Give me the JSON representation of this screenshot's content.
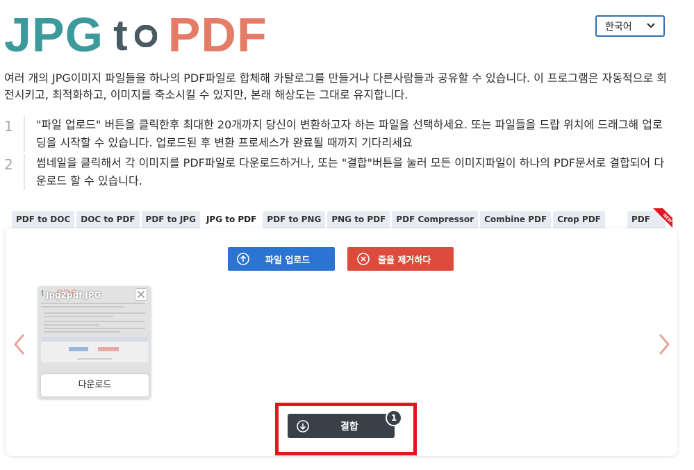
{
  "logo": {
    "part1": "JPG",
    "part2": "t",
    "part3": "PDF"
  },
  "language": {
    "selected": "한국어"
  },
  "intro": "여러 개의 JPG이미지 파일들을 하나의 PDF파일로 합체해 카탈로그를 만들거나 다른사람들과 공유할 수 있습니다. 이 프로그램은 자동적으로 회전시키고, 최적화하고, 이미지를 축소시킬 수 있지만, 본래 해상도는 그대로 유지합니다.",
  "steps": [
    {
      "num": "1",
      "text": "\"파일 업로드\" 버튼을 클릭한후 최대한 20개까지 당신이 변환하고자 하는 파일을 선택하세요. 또는 파일들을 드랍 위치에 드래그해 업로딩을 시작할 수 있습니다. 업로드된 후 변환 프로세스가 완료될 때까지 기다리세요"
    },
    {
      "num": "2",
      "text": "썸네일을 클릭해서 각 이미지를 PDF파일로 다운로드하거나, 또는 \"결합\"버튼을 눌러 모든 이미지파일이 하나의 PDF문서로 결합되어 다운로드 할 수 있습니다."
    }
  ],
  "tabs": [
    "PDF to DOC",
    "DOC to PDF",
    "PDF to JPG",
    "JPG to PDF",
    "PDF to PNG",
    "PNG to PDF",
    "PDF Compressor",
    "Combine PDF",
    "Crop PDF"
  ],
  "tab_right": "PDF Kit",
  "new_ribbon": "NEW",
  "buttons": {
    "upload": "파일 업로드",
    "remove": "줄을 제거하다",
    "combine": "결합",
    "combine_count": "1"
  },
  "thumbnail": {
    "filename": "Jpg2pdf.JPG",
    "download": "다운로드"
  },
  "colors": {
    "logo_teal": "#3d9a9c",
    "logo_gray": "#4a5a63",
    "logo_orange": "#e57c67",
    "upload_blue": "#2b74d1",
    "remove_red": "#dc4b3c",
    "combine_dark": "#3a4048",
    "highlight_red": "#e3161e"
  },
  "icons": {
    "upload": "arrow-up-circle-icon",
    "remove": "x-circle-icon",
    "combine": "arrow-down-circle-icon",
    "nav_left": "chevron-left-icon",
    "nav_right": "chevron-right-icon",
    "close": "close-icon",
    "lang": "chevron-down-icon"
  }
}
